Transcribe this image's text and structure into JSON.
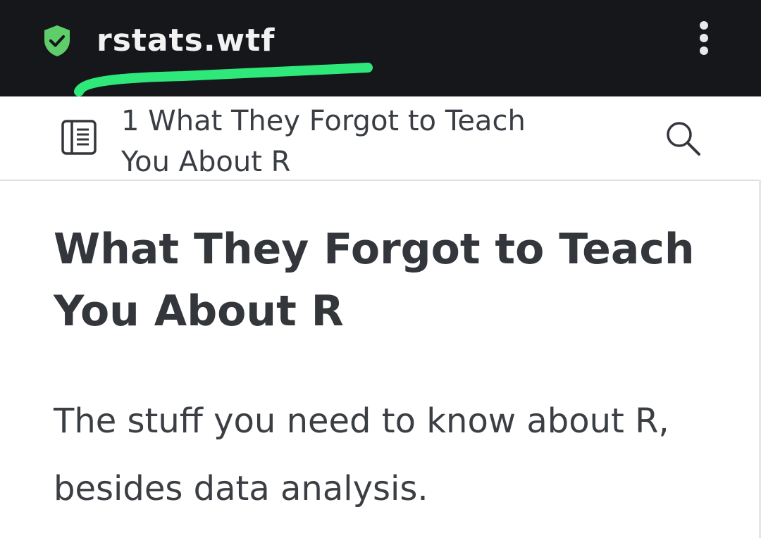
{
  "browser": {
    "url": "rstats.wtf",
    "shield_color": "#5fce6a",
    "underline_color": "#2ee87a",
    "menu_icon": "kebab-menu-icon"
  },
  "navbar": {
    "toc_icon": "table-of-contents-icon",
    "title": "1  What They Forgot to Teach You About R",
    "search_icon": "search-icon"
  },
  "main": {
    "title": "What They Forgot to Teach You About R",
    "subtitle": "The stuff you need to know about R, besides data analysis."
  }
}
